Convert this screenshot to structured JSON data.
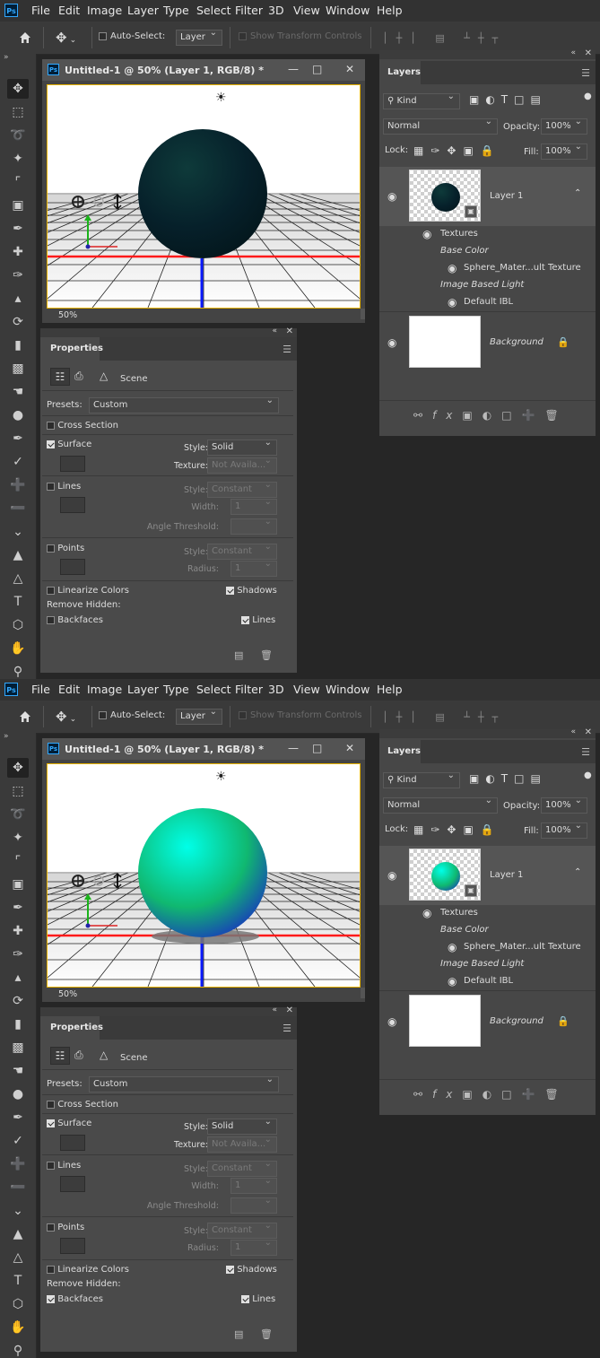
{
  "menu": {
    "logo": "Ps",
    "items": [
      "File",
      "Edit",
      "Image",
      "Layer",
      "Type",
      "Select",
      "Filter",
      "3D",
      "View",
      "Window",
      "Help"
    ]
  },
  "options": {
    "auto_select_label": "Auto-Select:",
    "auto_select_target": "Layer",
    "show_transform_controls": "Show Transform Controls"
  },
  "document": {
    "title": "Untitled-1 @ 50% (Layer 1, RGB/8) *",
    "zoom": "50%"
  },
  "properties": {
    "tab": "Properties",
    "scene_label": "Scene",
    "presets_label": "Presets:",
    "presets_value": "Custom",
    "cross_section": "Cross Section",
    "surface": "Surface",
    "style_label": "Style:",
    "surface_style": "Solid",
    "texture_label": "Texture:",
    "texture_value": "Not Availa...",
    "lines": "Lines",
    "lines_style": "Constant",
    "width_label": "Width:",
    "width_value": "1",
    "angle_threshold_label": "Angle Threshold:",
    "points": "Points",
    "points_style": "Constant",
    "radius_label": "Radius:",
    "radius_value": "1",
    "linearize_colors": "Linearize Colors",
    "shadows": "Shadows",
    "remove_hidden": "Remove Hidden:",
    "backfaces": "Backfaces",
    "lines_hidden": "Lines"
  },
  "layers": {
    "tab": "Layers",
    "kind": "Kind",
    "blend": "Normal",
    "opacity_label": "Opacity:",
    "opacity": "100%",
    "lock_label": "Lock:",
    "fill_label": "Fill:",
    "fill": "100%",
    "layer1": "Layer 1",
    "textures": "Textures",
    "base_color": "Base Color",
    "sphere_material": "Sphere_Mater...ult Texture",
    "ibl": "Image Based Light",
    "default_ibl": "Default IBL",
    "background": "Background"
  },
  "states": [
    {
      "sphere_colors": [
        "#0e3a3a",
        "#06202a",
        "#031418"
      ],
      "ground_shadow": false,
      "backfaces_checked": false
    },
    {
      "sphere_colors": [
        "#00ffe8",
        "#10b870",
        "#1a1ad0"
      ],
      "ground_shadow": true,
      "backfaces_checked": true
    }
  ],
  "colors": {
    "accent_border": "#e8b200",
    "ps_blue": "#31a8ff",
    "axis_red": "#ff1a1a",
    "axis_blue": "#0a1aff",
    "axis_green": "#1ab31a"
  }
}
